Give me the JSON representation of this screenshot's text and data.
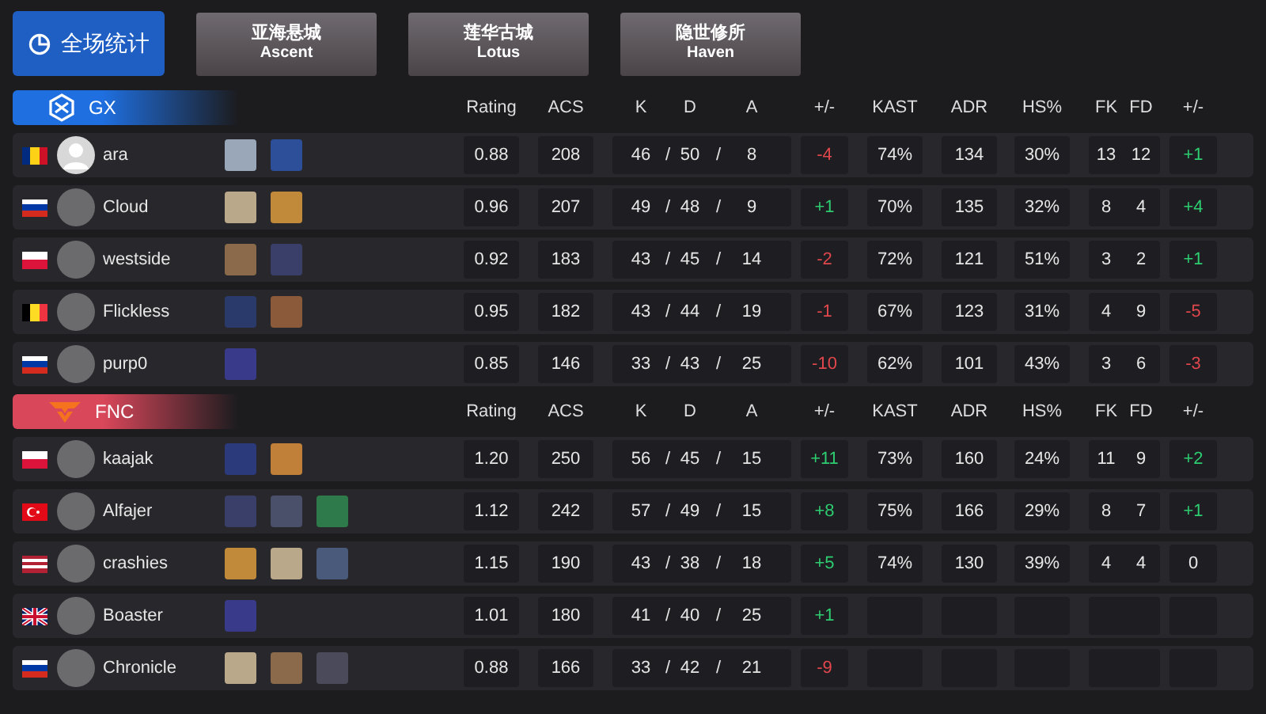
{
  "overview_button": {
    "label": "全场统计",
    "selected": true
  },
  "maps": [
    {
      "name": "亚海悬城",
      "subtitle": "Ascent",
      "selected": false
    },
    {
      "name": "莲华古城",
      "subtitle": "Lotus",
      "selected": false
    },
    {
      "name": "隐世修所",
      "subtitle": "Haven",
      "selected": false
    }
  ],
  "teams": [
    {
      "name": "GX",
      "kind": "gx",
      "color": "#1f6fe0",
      "columns": [
        "Rating",
        "ACS",
        "K",
        "D",
        "A",
        "+/-",
        "KAST",
        "ADR",
        "HS%",
        "FK",
        "FD",
        "+/-"
      ],
      "players": [
        {
          "flag": {
            "kind": "ro"
          },
          "avatar": {
            "kind": "silhouette"
          },
          "name": "ara",
          "agents": [
            {
              "color": "#9aa7b8"
            },
            {
              "color": "#2d4f9a"
            }
          ],
          "rating": "0.88",
          "acs": "208",
          "kda": [
            "46",
            "/",
            "50",
            "/",
            "8"
          ],
          "diff": {
            "text": "-4",
            "kind": "negative"
          },
          "kast": "74%",
          "adr": "134",
          "hs": "30%",
          "fkfd": [
            "13",
            "12"
          ],
          "fk_diff": {
            "text": "+1",
            "kind": "positive"
          }
        },
        {
          "flag": {
            "kind": "ru"
          },
          "avatar": {
            "kind": "photo"
          },
          "name": "Cloud",
          "agents": [
            {
              "color": "#b9a98a"
            },
            {
              "color": "#c08a3a"
            }
          ],
          "rating": "0.96",
          "acs": "207",
          "kda": [
            "49",
            "/",
            "48",
            "/",
            "9"
          ],
          "diff": {
            "text": "+1",
            "kind": "positive"
          },
          "kast": "70%",
          "adr": "135",
          "hs": "32%",
          "fkfd": [
            "8",
            "4"
          ],
          "fk_diff": {
            "text": "+4",
            "kind": "positive"
          }
        },
        {
          "flag": {
            "kind": "pl"
          },
          "avatar": {
            "kind": "photo"
          },
          "name": "westside",
          "agents": [
            {
              "color": "#8a6a4a"
            },
            {
              "color": "#3a3f6a"
            }
          ],
          "rating": "0.92",
          "acs": "183",
          "kda": [
            "43",
            "/",
            "45",
            "/",
            "14"
          ],
          "diff": {
            "text": "-2",
            "kind": "negative"
          },
          "kast": "72%",
          "adr": "121",
          "hs": "51%",
          "fkfd": [
            "3",
            "2"
          ],
          "fk_diff": {
            "text": "+1",
            "kind": "positive"
          }
        },
        {
          "flag": {
            "kind": "be"
          },
          "avatar": {
            "kind": "photo"
          },
          "name": "Flickless",
          "agents": [
            {
              "color": "#2a3a6a"
            },
            {
              "color": "#8a5a3a"
            }
          ],
          "rating": "0.95",
          "acs": "182",
          "kda": [
            "43",
            "/",
            "44",
            "/",
            "19"
          ],
          "diff": {
            "text": "-1",
            "kind": "negative"
          },
          "kast": "67%",
          "adr": "123",
          "hs": "31%",
          "fkfd": [
            "4",
            "9"
          ],
          "fk_diff": {
            "text": "-5",
            "kind": "negative"
          }
        },
        {
          "flag": {
            "kind": "ru"
          },
          "avatar": {
            "kind": "photo"
          },
          "name": "purp0",
          "agents": [
            {
              "color": "#3a3a8a"
            }
          ],
          "rating": "0.85",
          "acs": "146",
          "kda": [
            "33",
            "/",
            "43",
            "/",
            "25"
          ],
          "diff": {
            "text": "-10",
            "kind": "negative"
          },
          "kast": "62%",
          "adr": "101",
          "hs": "43%",
          "fkfd": [
            "3",
            "6"
          ],
          "fk_diff": {
            "text": "-3",
            "kind": "negative"
          }
        }
      ]
    },
    {
      "name": "FNC",
      "kind": "fnc",
      "color": "#d9475a",
      "columns": [
        "Rating",
        "ACS",
        "K",
        "D",
        "A",
        "+/-",
        "KAST",
        "ADR",
        "HS%",
        "FK",
        "FD",
        "+/-"
      ],
      "players": [
        {
          "flag": {
            "kind": "pl"
          },
          "avatar": {
            "kind": "photo"
          },
          "name": "kaajak",
          "agents": [
            {
              "color": "#2a3a7a"
            },
            {
              "color": "#c0803a"
            }
          ],
          "rating": "1.20",
          "acs": "250",
          "kda": [
            "56",
            "/",
            "45",
            "/",
            "15"
          ],
          "diff": {
            "text": "+11",
            "kind": "positive"
          },
          "kast": "73%",
          "adr": "160",
          "hs": "24%",
          "fkfd": [
            "11",
            "9"
          ],
          "fk_diff": {
            "text": "+2",
            "kind": "positive"
          }
        },
        {
          "flag": {
            "kind": "tr"
          },
          "avatar": {
            "kind": "photo"
          },
          "name": "Alfajer",
          "agents": [
            {
              "color": "#3a3f6a"
            },
            {
              "color": "#4a4f6a"
            },
            {
              "color": "#2f7a4a"
            }
          ],
          "rating": "1.12",
          "acs": "242",
          "kda": [
            "57",
            "/",
            "49",
            "/",
            "15"
          ],
          "diff": {
            "text": "+8",
            "kind": "positive"
          },
          "kast": "75%",
          "adr": "166",
          "hs": "29%",
          "fkfd": [
            "8",
            "7"
          ],
          "fk_diff": {
            "text": "+1",
            "kind": "positive"
          }
        },
        {
          "flag": {
            "kind": "us"
          },
          "avatar": {
            "kind": "photo"
          },
          "name": "crashies",
          "agents": [
            {
              "color": "#c08a3a"
            },
            {
              "color": "#b9a98a"
            },
            {
              "color": "#4a5a7a"
            }
          ],
          "rating": "1.15",
          "acs": "190",
          "kda": [
            "43",
            "/",
            "38",
            "/",
            "18"
          ],
          "diff": {
            "text": "+5",
            "kind": "positive"
          },
          "kast": "74%",
          "adr": "130",
          "hs": "39%",
          "fkfd": [
            "4",
            "4"
          ],
          "fk_diff": {
            "text": "0",
            "kind": "neutral"
          }
        },
        {
          "flag": {
            "kind": "gb"
          },
          "avatar": {
            "kind": "photo"
          },
          "name": "Boaster",
          "agents": [
            {
              "color": "#3a3a8a"
            }
          ],
          "rating": "1.01",
          "acs": "180",
          "kda": [
            "41",
            "/",
            "40",
            "/",
            "25"
          ],
          "diff": {
            "text": "+1",
            "kind": "positive"
          }
        },
        {
          "flag": {
            "kind": "ru"
          },
          "avatar": {
            "kind": "photo"
          },
          "name": "Chronicle",
          "agents": [
            {
              "color": "#b9a98a"
            },
            {
              "color": "#8a6a4a"
            },
            {
              "color": "#4a4a5a"
            }
          ],
          "rating": "0.88",
          "acs": "166",
          "kda": [
            "33",
            "/",
            "42",
            "/",
            "21"
          ],
          "diff": {
            "text": "-9",
            "kind": "negative"
          }
        }
      ]
    }
  ]
}
